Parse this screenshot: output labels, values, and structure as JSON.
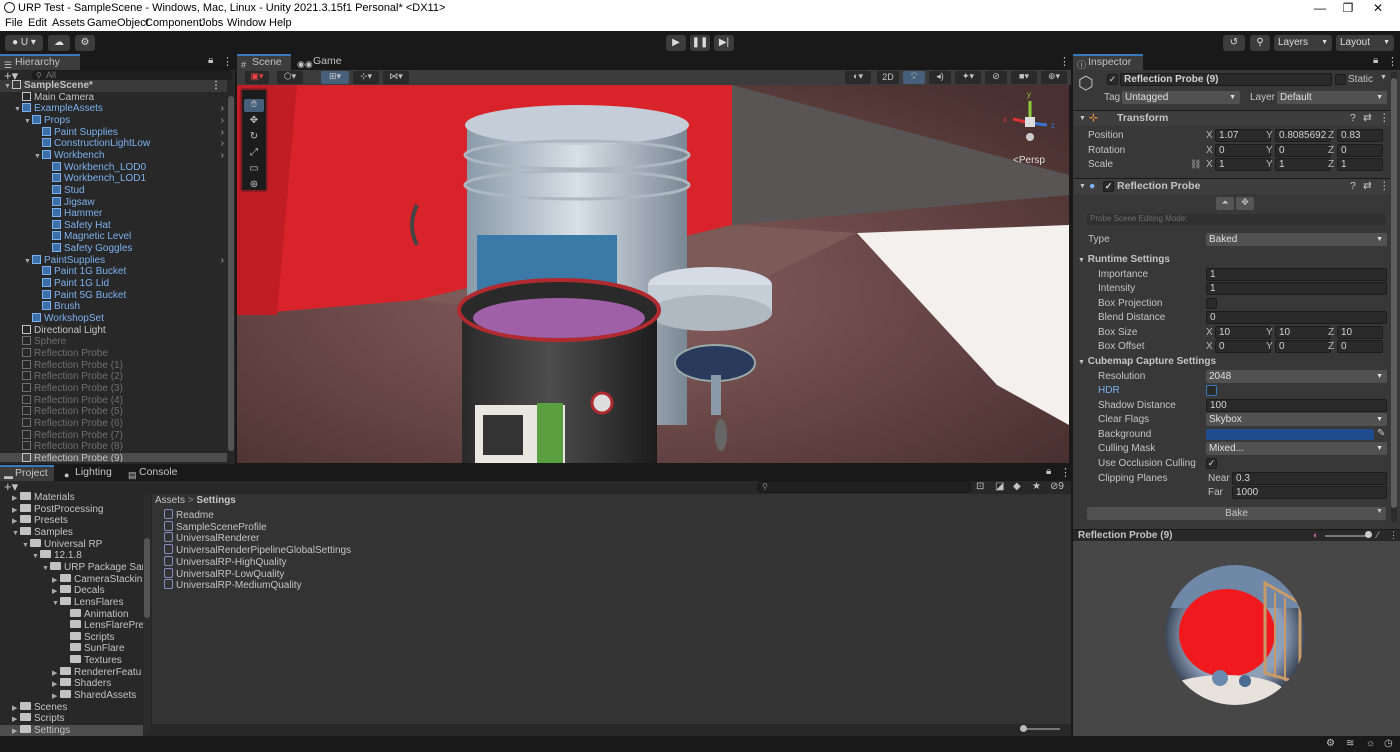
{
  "window": {
    "title": "URP Test - SampleScene - Windows, Mac, Linux - Unity 2021.3.15f1 Personal* <DX11>",
    "minimize": "—",
    "restore": "❐",
    "close": "✕"
  },
  "menu": [
    "File",
    "Edit",
    "Assets",
    "GameObject",
    "Component",
    "Jobs",
    "Window",
    "Help"
  ],
  "toolbar": {
    "account": "U",
    "layers": "Layers",
    "layout": "Layout"
  },
  "hierarchy": {
    "tab": "Hierarchy",
    "search_placeholder": "All",
    "items": [
      {
        "label": "SampleScene*",
        "depth": 0,
        "style": "scene"
      },
      {
        "label": "Main Camera",
        "depth": 1,
        "style": "normal"
      },
      {
        "label": "ExampleAssets",
        "depth": 1,
        "style": "prefab"
      },
      {
        "label": "Props",
        "depth": 2,
        "style": "prefab"
      },
      {
        "label": "Paint Supplies",
        "depth": 3,
        "style": "prefab"
      },
      {
        "label": "ConstructionLightLow",
        "depth": 3,
        "style": "prefab"
      },
      {
        "label": "Workbench",
        "depth": 3,
        "style": "prefab"
      },
      {
        "label": "Workbench_LOD0",
        "depth": 4,
        "style": "prefab"
      },
      {
        "label": "Workbench_LOD1",
        "depth": 4,
        "style": "prefab"
      },
      {
        "label": "Stud",
        "depth": 4,
        "style": "prefab"
      },
      {
        "label": "Jigsaw",
        "depth": 4,
        "style": "prefab"
      },
      {
        "label": "Hammer",
        "depth": 4,
        "style": "prefab"
      },
      {
        "label": "Safety Hat",
        "depth": 4,
        "style": "prefab"
      },
      {
        "label": "Magnetic Level",
        "depth": 4,
        "style": "prefab"
      },
      {
        "label": "Safety Goggles",
        "depth": 4,
        "style": "prefab"
      },
      {
        "label": "PaintSupplies",
        "depth": 2,
        "style": "prefab"
      },
      {
        "label": "Paint 1G Bucket",
        "depth": 3,
        "style": "prefab"
      },
      {
        "label": "Paint 1G Lid",
        "depth": 3,
        "style": "prefab"
      },
      {
        "label": "Paint 5G Bucket",
        "depth": 3,
        "style": "prefab"
      },
      {
        "label": "Brush",
        "depth": 3,
        "style": "prefab"
      },
      {
        "label": "WorkshopSet",
        "depth": 2,
        "style": "prefab"
      },
      {
        "label": "Directional Light",
        "depth": 1,
        "style": "normal"
      },
      {
        "label": "Sphere",
        "depth": 1,
        "style": "disabled"
      },
      {
        "label": "Reflection Probe",
        "depth": 1,
        "style": "disabled"
      },
      {
        "label": "Reflection Probe (1)",
        "depth": 1,
        "style": "disabled"
      },
      {
        "label": "Reflection Probe (2)",
        "depth": 1,
        "style": "disabled"
      },
      {
        "label": "Reflection Probe (3)",
        "depth": 1,
        "style": "disabled"
      },
      {
        "label": "Reflection Probe (4)",
        "depth": 1,
        "style": "disabled"
      },
      {
        "label": "Reflection Probe (5)",
        "depth": 1,
        "style": "disabled"
      },
      {
        "label": "Reflection Probe (6)",
        "depth": 1,
        "style": "disabled"
      },
      {
        "label": "Reflection Probe (7)",
        "depth": 1,
        "style": "disabled"
      },
      {
        "label": "Reflection Probe (8)",
        "depth": 1,
        "style": "disabled"
      },
      {
        "label": "Reflection Probe (9)",
        "depth": 1,
        "style": "selected"
      }
    ]
  },
  "scene_tabs": {
    "scene": "Scene",
    "game": "Game"
  },
  "scene_view": {
    "mode_2d": "2D",
    "persp": "Persp",
    "gizmo_axes": {
      "y": "y",
      "x": "x",
      "z": "z"
    }
  },
  "bottom_tabs": {
    "project": "Project",
    "lighting": "Lighting",
    "console": "Console"
  },
  "project": {
    "search_badge": "9",
    "tree": [
      {
        "label": "Materials",
        "depth": 1
      },
      {
        "label": "PostProcessing",
        "depth": 1
      },
      {
        "label": "Presets",
        "depth": 1
      },
      {
        "label": "Samples",
        "depth": 1
      },
      {
        "label": "Universal RP",
        "depth": 2
      },
      {
        "label": "12.1.8",
        "depth": 3
      },
      {
        "label": "URP Package Sam",
        "depth": 4
      },
      {
        "label": "CameraStackin",
        "depth": 5
      },
      {
        "label": "Decals",
        "depth": 5
      },
      {
        "label": "LensFlares",
        "depth": 5
      },
      {
        "label": "Animation",
        "depth": 6
      },
      {
        "label": "LensFlarePre",
        "depth": 6
      },
      {
        "label": "Scripts",
        "depth": 6
      },
      {
        "label": "SunFlare",
        "depth": 6
      },
      {
        "label": "Textures",
        "depth": 6
      },
      {
        "label": "RendererFeatu",
        "depth": 5
      },
      {
        "label": "Shaders",
        "depth": 5
      },
      {
        "label": "SharedAssets",
        "depth": 5
      },
      {
        "label": "Scenes",
        "depth": 1
      },
      {
        "label": "Scripts",
        "depth": 1
      },
      {
        "label": "Settings",
        "depth": 1
      }
    ],
    "breadcrumb": {
      "root": "Assets",
      "current": "Settings"
    },
    "assets": [
      "Readme",
      "SampleSceneProfile",
      "UniversalRenderer",
      "UniversalRenderPipelineGlobalSettings",
      "UniversalRP-HighQuality",
      "UniversalRP-LowQuality",
      "UniversalRP-MediumQuality"
    ]
  },
  "inspector": {
    "tab": "Inspector",
    "object_name": "Reflection Probe (9)",
    "static_label": "Static",
    "tag_label": "Tag",
    "tag_value": "Untagged",
    "layer_label": "Layer",
    "layer_value": "Default",
    "transform": {
      "title": "Transform",
      "position_label": "Position",
      "position": {
        "x": "1.07",
        "y": "0.8085692",
        "z": "0.83"
      },
      "rotation_label": "Rotation",
      "rotation": {
        "x": "0",
        "y": "0",
        "z": "0"
      },
      "scale_label": "Scale",
      "scale": {
        "x": "1",
        "y": "1",
        "z": "1"
      }
    },
    "probe": {
      "title": "Reflection Probe",
      "editing_mode": "Probe Scene Editing Mode:",
      "type_label": "Type",
      "type_value": "Baked",
      "runtime_title": "Runtime Settings",
      "importance_label": "Importance",
      "importance": "1",
      "intensity_label": "Intensity",
      "intensity": "1",
      "box_projection_label": "Box Projection",
      "blend_distance_label": "Blend Distance",
      "blend_distance": "0",
      "box_size_label": "Box Size",
      "box_size": {
        "x": "10",
        "y": "10",
        "z": "10"
      },
      "box_offset_label": "Box Offset",
      "box_offset": {
        "x": "0",
        "y": "0",
        "z": "0"
      },
      "cubemap_title": "Cubemap Capture Settings",
      "resolution_label": "Resolution",
      "resolution": "2048",
      "hdr_label": "HDR",
      "shadow_distance_label": "Shadow Distance",
      "shadow_distance": "100",
      "clear_flags_label": "Clear Flags",
      "clear_flags": "Skybox",
      "background_label": "Background",
      "background_color": "#1e4a8e",
      "culling_mask_label": "Culling Mask",
      "culling_mask": "Mixed...",
      "occlusion_label": "Use Occlusion Culling",
      "clipping_label": "Clipping Planes",
      "near_label": "Near",
      "near": "0.3",
      "far_label": "Far",
      "far": "1000",
      "bake_button": "Bake"
    },
    "preview_title": "Reflection Probe (9)"
  },
  "axes": {
    "x": "X",
    "y": "Y",
    "z": "Z"
  },
  "colors": {
    "accent": "#3a79bb",
    "prefab_text": "#7cb1ef",
    "selection": "#4d4d4d"
  }
}
